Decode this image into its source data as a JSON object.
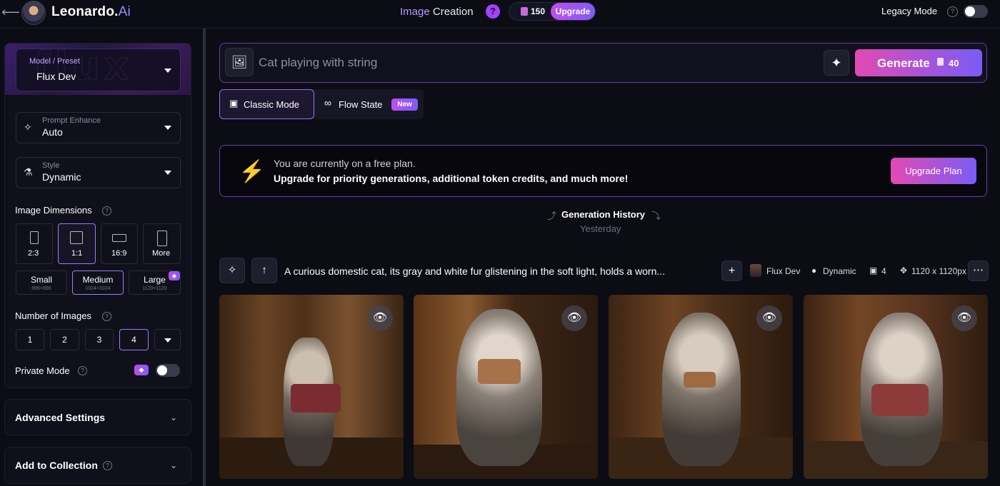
{
  "header": {
    "brand": "Leonardo.",
    "brand_ai": "Ai",
    "page_title_a": "Image",
    "page_title_b": "Creation",
    "help": "?",
    "tokens": "150",
    "upgrade": "Upgrade",
    "legacy_mode": "Legacy Mode"
  },
  "sidebar": {
    "model_label": "Model / Preset",
    "model_value": "Flux Dev",
    "banner_text": "flux",
    "prompt_enhance_label": "Prompt Enhance",
    "prompt_enhance_value": "Auto",
    "style_label": "Style",
    "style_value": "Dynamic",
    "dimensions_label": "Image Dimensions",
    "ratios": [
      "2:3",
      "1:1",
      "16:9",
      "More"
    ],
    "sizes": [
      {
        "label": "Small",
        "sub": "896×896"
      },
      {
        "label": "Medium",
        "sub": "1024×1024"
      },
      {
        "label": "Large",
        "sub": "1120×1120"
      }
    ],
    "num_images_label": "Number of Images",
    "num_images": [
      "1",
      "2",
      "3",
      "4"
    ],
    "private_mode": "Private Mode",
    "advanced": "Advanced Settings",
    "collection": "Add to Collection"
  },
  "main": {
    "prompt": "Cat playing with string",
    "generate": "Generate",
    "generate_cost": "40",
    "classic_mode": "Classic Mode",
    "flow_state": "Flow State",
    "new_badge": "New",
    "promo_line1": "You are currently on a free plan.",
    "promo_line2": "Upgrade for priority generations, additional token credits, and much more!",
    "upgrade_plan": "Upgrade Plan",
    "history_title": "Generation History",
    "history_sub": "Yesterday",
    "gen_prompt": "A curious domestic cat, its gray and white fur glistening in the soft light, holds a worn...",
    "meta_model": "Flux Dev",
    "meta_style": "Dynamic",
    "meta_count": "4",
    "meta_size": "1120 x 1120px"
  },
  "colors": {
    "accent": "#9b7cff",
    "gradient_start": "#e24ab3",
    "gradient_end": "#7a5cf6",
    "bolt": "#f59a25"
  },
  "icons": [
    "back-arrow-icon",
    "image-icon",
    "sparkle-icon",
    "eye-icon",
    "bolt-icon",
    "chevron-down-icon",
    "gem-icon",
    "wand-icon",
    "arrow-up-icon",
    "plus-icon",
    "more-icon"
  ]
}
